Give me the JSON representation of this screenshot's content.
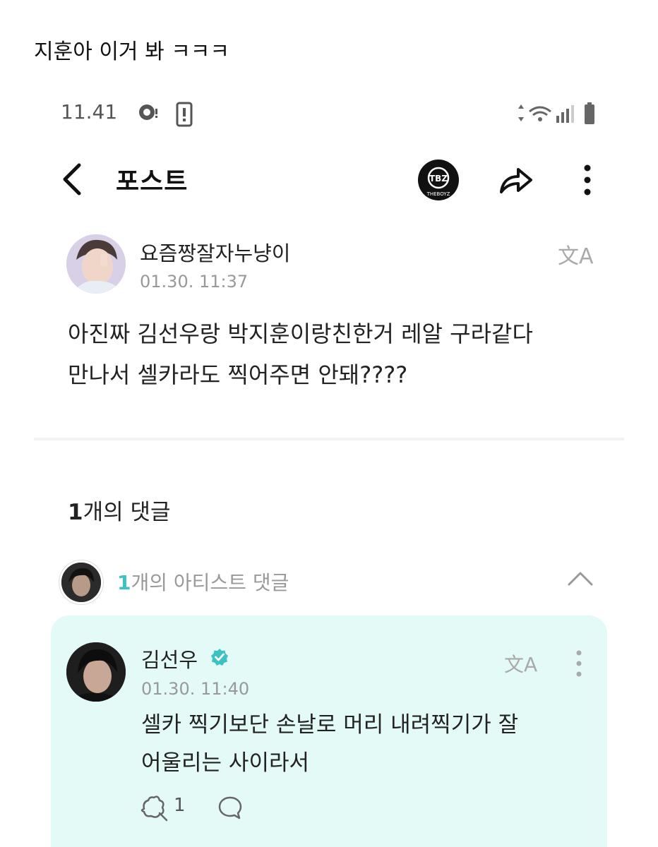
{
  "caption": "지훈아 이거 봐 ㅋㅋㅋ",
  "status_bar": {
    "time": "11.41"
  },
  "app_bar": {
    "title": "포스트",
    "logo_text": "TBZ",
    "logo_subtext": "THEBOYZ"
  },
  "post": {
    "author": "요즘짱잘자누냥이",
    "timestamp": "01.30. 11:37",
    "translate_label": "文A",
    "lines": [
      "아진짜 김선우랑 박지훈이랑친한거 레알 구라같다",
      "만나서 셀카라도 찍어주면 안돼????"
    ]
  },
  "comments": {
    "count_num": "1",
    "count_suffix": "개의 댓글",
    "artist_count_num": "1",
    "artist_count_suffix": "개의 아티스트 댓글"
  },
  "artist_comment": {
    "author": "김선우",
    "timestamp": "01.30. 11:40",
    "translate_label": "文A",
    "lines": [
      "셀카 찍기보단 손날로 머리 내려찍기가 잘",
      "어울리는 사이라서"
    ],
    "reaction_count": "1"
  },
  "colors": {
    "accent": "#3cc1c4",
    "card_bg": "#e3faf6",
    "verified": "#3cc1c4"
  }
}
